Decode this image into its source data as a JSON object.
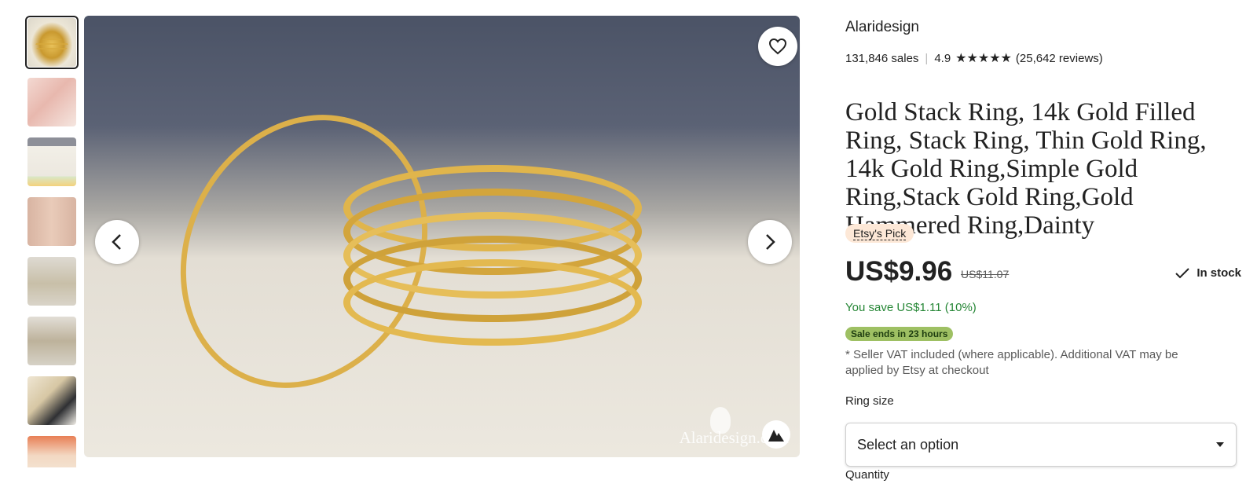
{
  "gallery": {
    "thumbnails": [
      "gold-rings",
      "hand",
      "details-sheet",
      "wrist",
      "flat-rings",
      "flat-rings-2",
      "gift-box",
      "gift-wrap"
    ],
    "active_index": 0,
    "watermark": "Alaridesign.com"
  },
  "listing": {
    "shop_name": "Alaridesign",
    "sales": "131,846 sales",
    "rating": "4.9",
    "stars": "★★★★★",
    "reviews": "(25,642 reviews)",
    "title": "Gold Stack Ring, 14k Gold Filled Ring, Stack Ring, Thin Gold Ring, 14k Gold Ring,Simple Gold Ring,Stack Gold Ring,Gold Hammered Ring,Dainty",
    "badge": "Etsy's Pick",
    "price": "US$9.96",
    "original_price": "US$11.07",
    "stock_status": "In stock",
    "savings": "You save US$1.11 (10%)",
    "sale_badge": "Sale ends in 23 hours",
    "vat_note": "* Seller VAT included (where applicable). Additional VAT may be applied by Etsy at checkout"
  },
  "options": {
    "ring_size_label": "Ring size",
    "ring_size_value": "Select an option",
    "quantity_label": "Quantity"
  },
  "colors": {
    "savings_green": "#258635",
    "sale_badge_bg": "#9ec063",
    "pick_badge_bg": "#fde8d7"
  }
}
